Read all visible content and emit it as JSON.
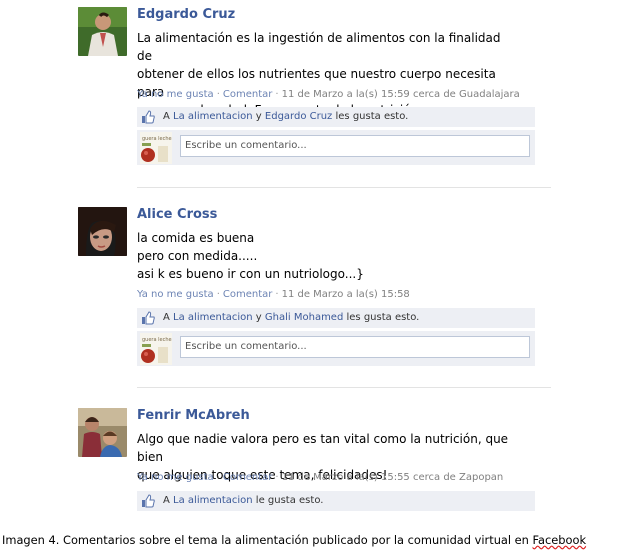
{
  "posts": [
    {
      "author": "Edgardo Cruz",
      "text": "La alimentación es la ingestión de alimentos con la finalidad de\nobtener de ellos los nutrientes que nuestro cuerpo necesita para\nconservar la salud. Forma parte de la nutrición",
      "unlike": "Ya no me gusta",
      "comment": "Comentar",
      "time": "11 de Marzo a la(s) 15:59 cerca de Guadalajara",
      "likes_prefix": "A",
      "likes_name1": "La alimentacion",
      "likes_conj": "y",
      "likes_name2": "Edgardo Cruz",
      "likes_suffix": "les gusta esto.",
      "comment_placeholder": "Escribe un comentario...",
      "avatar_icon": "man-avatar-icon"
    },
    {
      "author": "Alice Cross",
      "text": "la comida es buena\npero con medida.....\nasi k es bueno ir con un nutriologo...}",
      "unlike": "Ya no me gusta",
      "comment": "Comentar",
      "time": "11 de Marzo a la(s) 15:58",
      "likes_prefix": "A",
      "likes_name1": "La alimentacion",
      "likes_conj": "y",
      "likes_name2": "Ghali Mohamed",
      "likes_suffix": "les gusta esto.",
      "comment_placeholder": "Escribe un comentario...",
      "avatar_icon": "woman-avatar-icon"
    },
    {
      "author": "Fenrir McAbreh",
      "text": "Algo que nadie valora pero es tan vital como la nutrición, que bien\nque alguien toque este tema, felicidades!",
      "unlike": "Ya no me gusta",
      "comment": "Comentar",
      "time": "11 de Marzo a la(s) 15:55 cerca de Zapopan",
      "likes_prefix": "A",
      "likes_name1": "La alimentacion",
      "likes_suffix": "le gusta esto.",
      "avatar_icon": "family-avatar-icon"
    }
  ],
  "commenter_avatar_text": "guera leche",
  "caption_main": "Imagen 4. Comentarios sobre el tema la alimentación publicado por la comunidad virtual en ",
  "caption_link": "Facebook",
  "colors": {
    "link": "#3b5998",
    "meta_link": "#6d84b4",
    "meta_text": "#808080",
    "panel": "#edeff4",
    "input_border": "#bdc7d8"
  }
}
